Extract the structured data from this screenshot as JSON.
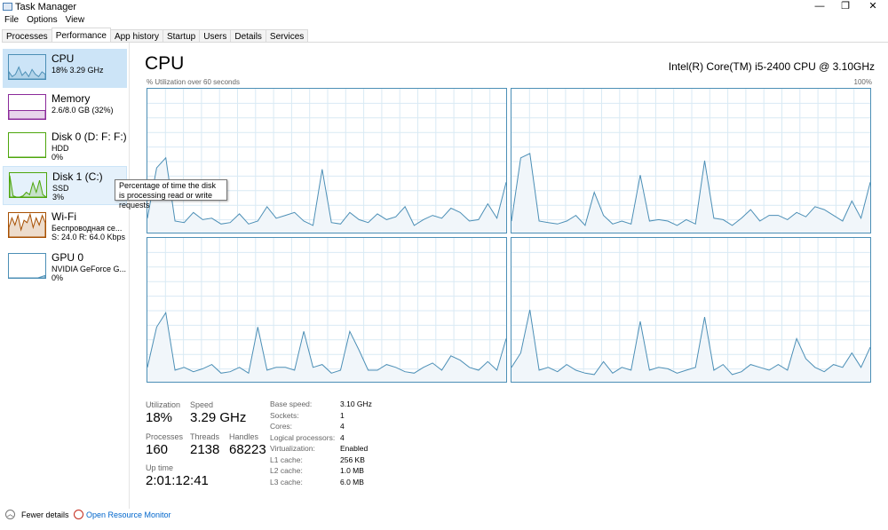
{
  "window": {
    "title": "Task Manager",
    "min": "—",
    "max": "❐",
    "close": "✕"
  },
  "menu": [
    "File",
    "Options",
    "View"
  ],
  "tabs": [
    "Processes",
    "Performance",
    "App history",
    "Startup",
    "Users",
    "Details",
    "Services"
  ],
  "active_tab": "Performance",
  "sidebar": [
    {
      "name": "CPU",
      "line1": "18% 3.29 GHz",
      "line2": "",
      "color": "#4c8fb6"
    },
    {
      "name": "Memory",
      "line1": "2.6/8.0 GB (32%)",
      "line2": "",
      "color": "#8b2a9a"
    },
    {
      "name": "Disk 0 (D: F: F:)",
      "line1": "HDD",
      "line2": "0%",
      "color": "#4da60c"
    },
    {
      "name": "Disk 1 (C:)",
      "line1": "SSD",
      "line2": "3%",
      "color": "#4da60c"
    },
    {
      "name": "Wi-Fi",
      "line1": "Беспроводная се...",
      "line2": "S: 24.0 R: 64.0 Kbps",
      "color": "#a74f01"
    },
    {
      "name": "GPU 0",
      "line1": "NVIDIA GeForce G...",
      "line2": "0%",
      "color": "#4c8fb6"
    }
  ],
  "tooltip": "Percentage of time the disk is processing read or write requests",
  "panel": {
    "title": "CPU",
    "model": "Intel(R) Core(TM) i5-2400 CPU @ 3.10GHz",
    "graph_label": "% Utilization over 60 seconds",
    "max_label": "100%"
  },
  "chart_data": {
    "type": "area",
    "ylim": [
      0,
      100
    ],
    "series": [
      {
        "values": [
          10,
          45,
          52,
          8,
          7,
          14,
          9,
          10,
          6,
          7,
          13,
          6,
          8,
          18,
          10,
          12,
          14,
          8,
          5,
          44,
          7,
          6,
          14,
          9,
          7,
          13,
          9,
          11,
          18,
          5,
          9,
          12,
          10,
          17,
          14,
          8,
          9,
          20,
          10,
          35
        ]
      },
      {
        "values": [
          8,
          52,
          55,
          8,
          7,
          6,
          8,
          12,
          5,
          28,
          12,
          6,
          8,
          6,
          40,
          8,
          9,
          8,
          5,
          9,
          6,
          50,
          10,
          9,
          5,
          10,
          16,
          8,
          12,
          12,
          9,
          14,
          11,
          18,
          16,
          12,
          8,
          22,
          10,
          35
        ]
      },
      {
        "values": [
          10,
          38,
          48,
          8,
          10,
          7,
          9,
          12,
          6,
          7,
          10,
          6,
          38,
          8,
          10,
          10,
          8,
          35,
          10,
          12,
          6,
          8,
          35,
          22,
          8,
          8,
          12,
          10,
          7,
          6,
          10,
          13,
          8,
          18,
          15,
          10,
          8,
          14,
          8,
          30
        ]
      },
      {
        "values": [
          10,
          20,
          50,
          8,
          10,
          7,
          12,
          8,
          6,
          5,
          14,
          6,
          10,
          8,
          42,
          8,
          10,
          9,
          6,
          8,
          10,
          45,
          8,
          12,
          5,
          7,
          12,
          10,
          8,
          12,
          8,
          30,
          16,
          10,
          7,
          12,
          10,
          20,
          10,
          24
        ]
      }
    ]
  },
  "stats": {
    "utilization_label": "Utilization",
    "utilization": "18%",
    "speed_label": "Speed",
    "speed": "3.29 GHz",
    "processes_label": "Processes",
    "processes": "160",
    "threads_label": "Threads",
    "threads": "2138",
    "handles_label": "Handles",
    "handles": "68223",
    "uptime_label": "Up time",
    "uptime": "2:01:12:41"
  },
  "details": [
    [
      "Base speed:",
      "3.10 GHz"
    ],
    [
      "Sockets:",
      "1"
    ],
    [
      "Cores:",
      "4"
    ],
    [
      "Logical processors:",
      "4"
    ],
    [
      "Virtualization:",
      "Enabled"
    ],
    [
      "L1 cache:",
      "256 KB"
    ],
    [
      "L2 cache:",
      "1.0 MB"
    ],
    [
      "L3 cache:",
      "6.0 MB"
    ]
  ],
  "footer": {
    "fewer": "Fewer details",
    "monitor": "Open Resource Monitor"
  }
}
